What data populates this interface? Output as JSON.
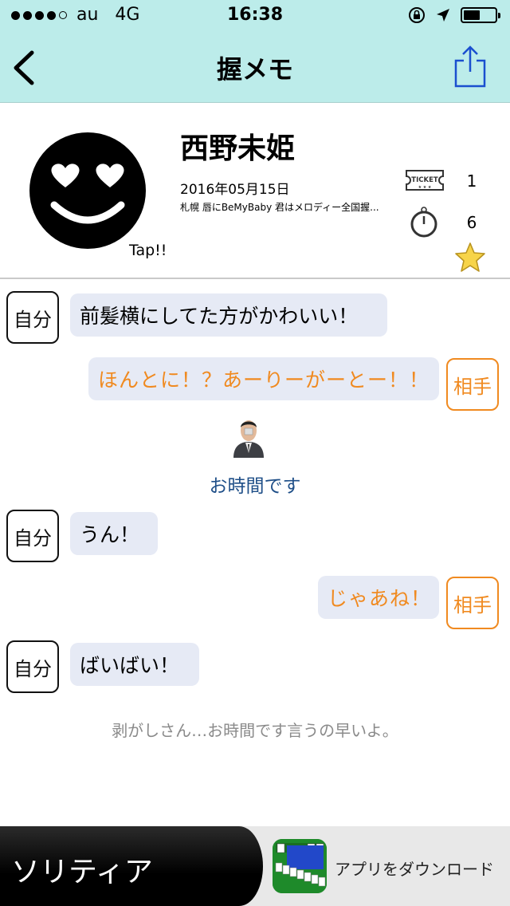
{
  "status_bar": {
    "carrier": "au",
    "network": "4G",
    "time": "16:38"
  },
  "nav": {
    "title": "握メモ",
    "back_icon": "chevron-left-icon",
    "share_icon": "share-icon"
  },
  "profile": {
    "name": "西野未姫",
    "date": "2016年05月15日",
    "description": "札幌 唇にBeMyBaby 君はメロディー全国握...",
    "tap_label": "Tap!!",
    "ticket_label": "TICKET",
    "ticket_count": "1",
    "time_count": "6",
    "accent_color": "#f08a20"
  },
  "chat": [
    {
      "speaker": "自分",
      "side": "me",
      "text": "前髪横にしてた方がかわいい！"
    },
    {
      "speaker": "相手",
      "side": "them",
      "text": "ほんとに！？あーりーがーとー！！"
    },
    {
      "notice": "お時間です"
    },
    {
      "speaker": "自分",
      "side": "me",
      "text": "うん！"
    },
    {
      "speaker": "相手",
      "side": "them",
      "text": "じゃあね！"
    },
    {
      "speaker": "自分",
      "side": "me",
      "text": "ばいばい！"
    }
  ],
  "memo": "剥がしさん…お時間です言うの早いよ。",
  "ad": {
    "title": "ソリティア",
    "cta": "アプリをダウンロード"
  }
}
